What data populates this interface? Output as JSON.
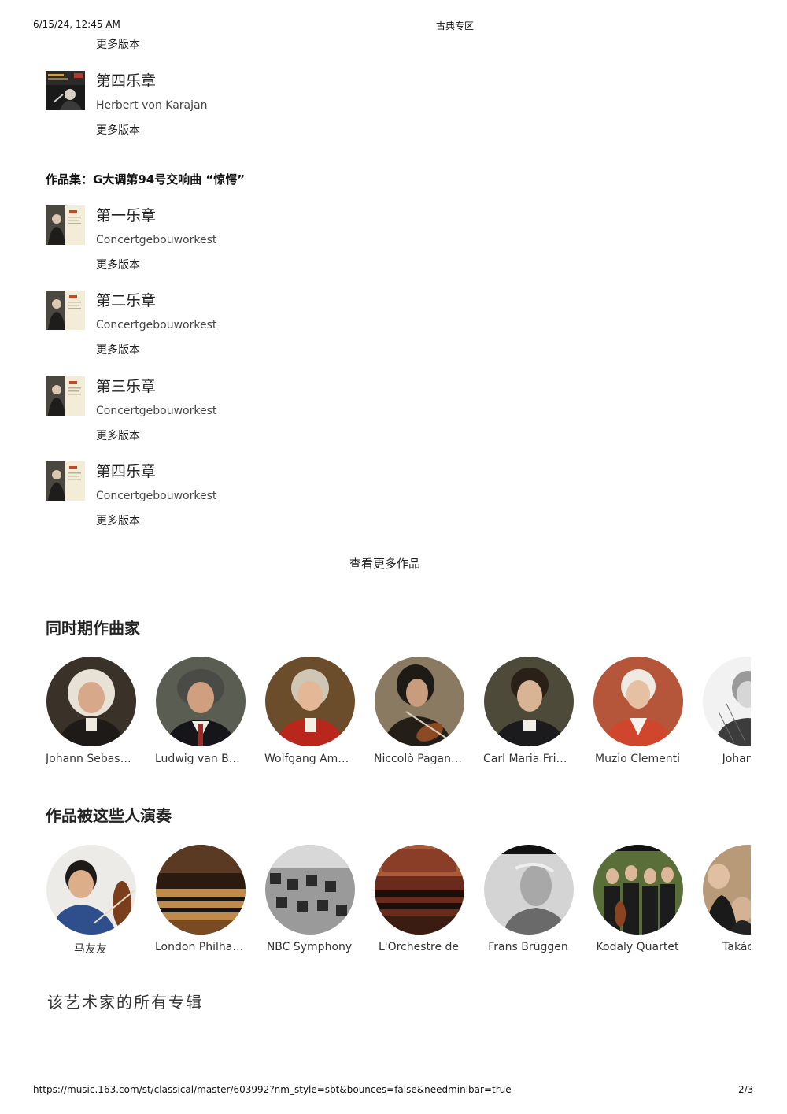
{
  "print_header": {
    "datetime": "6/15/24, 12:45 AM",
    "page_title": "古典专区"
  },
  "more_versions_label": "更多版本",
  "prev_track": {
    "title": "第四乐章",
    "artist": "Herbert von Karajan"
  },
  "work": {
    "title": "作品集：G大调第94号交响曲 “惊愕”",
    "tracks": [
      {
        "title": "第一乐章",
        "artist": "Concertgebouworkest"
      },
      {
        "title": "第二乐章",
        "artist": "Concertgebouworkest"
      },
      {
        "title": "第三乐章",
        "artist": "Concertgebouworkest"
      },
      {
        "title": "第四乐章",
        "artist": "Concertgebouworkest"
      }
    ]
  },
  "view_more_label": "查看更多作品",
  "composers_section": {
    "title": "同时期作曲家",
    "items": [
      {
        "name": "Johann Sebastian Bach",
        "icon": "composer-portrait-icon"
      },
      {
        "name": "Ludwig van Beethoven",
        "icon": "composer-portrait-icon"
      },
      {
        "name": "Wolfgang Amadeus Mozart",
        "icon": "composer-portrait-icon"
      },
      {
        "name": "Niccolò Paganini",
        "icon": "composer-portrait-icon"
      },
      {
        "name": "Carl Maria Friedrich",
        "icon": "composer-portrait-icon"
      },
      {
        "name": "Muzio Clementi",
        "icon": "composer-portrait-icon"
      },
      {
        "name": "Johann N",
        "icon": "composer-portrait-icon"
      }
    ]
  },
  "performers_section": {
    "title": "作品被这些人演奏",
    "items": [
      {
        "name": "马友友",
        "icon": "performer-photo-icon"
      },
      {
        "name": "London Philharmonic",
        "icon": "performer-photo-icon"
      },
      {
        "name": "NBC Symphony",
        "icon": "performer-photo-icon"
      },
      {
        "name": "L'Orchestre de",
        "icon": "performer-photo-icon"
      },
      {
        "name": "Frans Brüggen",
        "icon": "performer-photo-icon"
      },
      {
        "name": "Kodaly Quartet",
        "icon": "performer-photo-icon"
      },
      {
        "name": "Takács Q",
        "icon": "performer-photo-icon"
      }
    ]
  },
  "albums_title": "该艺术家的所有专辑",
  "print_footer": {
    "url": "https://music.163.com/st/classical/master/603992?nm_style=sbt&bounces=false&needminibar=true",
    "page": "2/3"
  },
  "colors": {
    "text": "#222222",
    "muted": "#444444",
    "background": "#ffffff"
  }
}
